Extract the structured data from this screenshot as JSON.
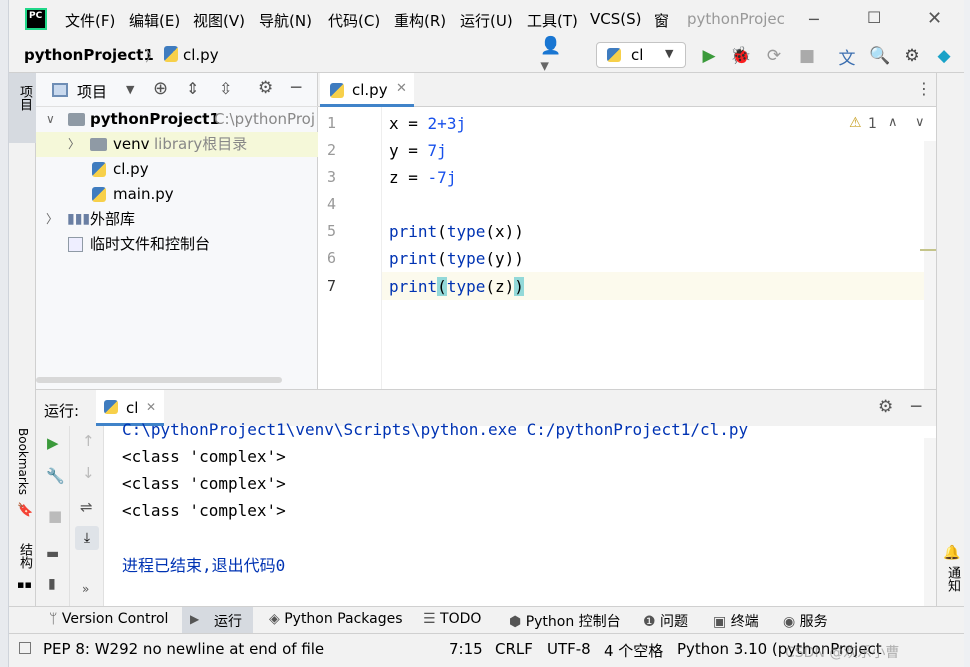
{
  "menubar": {
    "items": [
      "文件(F)",
      "编辑(E)",
      "视图(V)",
      "导航(N)",
      "代码(C)",
      "重构(R)",
      "运行(U)",
      "工具(T)",
      "VCS(S)",
      "窗"
    ],
    "window_title": "pythonProjec"
  },
  "breadcrumb": {
    "project": "pythonProject1",
    "file": "cl.py"
  },
  "run_config": {
    "selected": "cl"
  },
  "project_panel": {
    "title": "项目",
    "root_name": "pythonProject1",
    "root_path": "C:\\pythonProj",
    "venv_name": "venv",
    "venv_hint": "library根目录",
    "files": [
      "cl.py",
      "main.py"
    ],
    "external_libs": "外部库",
    "scratches": "临时文件和控制台"
  },
  "editor": {
    "tab": "cl.py",
    "warning_count": "1",
    "line_numbers": [
      "1",
      "2",
      "3",
      "4",
      "5",
      "6",
      "7"
    ],
    "lines": [
      {
        "var": "x",
        "eq": " = ",
        "val": "2+3j"
      },
      {
        "var": "y",
        "eq": " = ",
        "val": "7j"
      },
      {
        "var": "z",
        "eq": " = ",
        "val": "-7j"
      },
      {
        "print1": "print",
        "type1": "type",
        "arg1": "x"
      },
      {
        "print2": "print",
        "type2": "type",
        "arg2": "y"
      },
      {
        "print3": "print",
        "type3": "type",
        "arg3": "z"
      }
    ]
  },
  "run_panel": {
    "label": "运行:",
    "tab": "cl",
    "output": [
      "C:\\pythonProject1\\venv\\Scripts\\python.exe C:/pythonProject1/cl.py",
      "<class 'complex'>",
      "<class 'complex'>",
      "<class 'complex'>",
      "",
      "进程已结束,退出代码0"
    ]
  },
  "side_labels": {
    "project": "项目",
    "bookmarks": "Bookmarks",
    "structure": "结构",
    "notifications": "通知"
  },
  "bottom_tabs": [
    "Version Control",
    "运行",
    "Python Packages",
    "TODO",
    "Python 控制台",
    "问题",
    "终端",
    "服务"
  ],
  "status_bar": {
    "message": "PEP 8: W292 no newline at end of file",
    "position": "7:15",
    "line_sep": "CRLF",
    "encoding": "UTF-8",
    "indent": "4 个空格",
    "interpreter": "Python 3.10 (pythonProject",
    "watermark": "CSDN @欢乐小曹"
  },
  "colors": {
    "accent_green": "#3b9a3b",
    "keyword_blue": "#0033b3",
    "number_blue": "#1750eb",
    "bracket_highlight": "#93d9d9",
    "caret_line": "#fcfaed"
  }
}
